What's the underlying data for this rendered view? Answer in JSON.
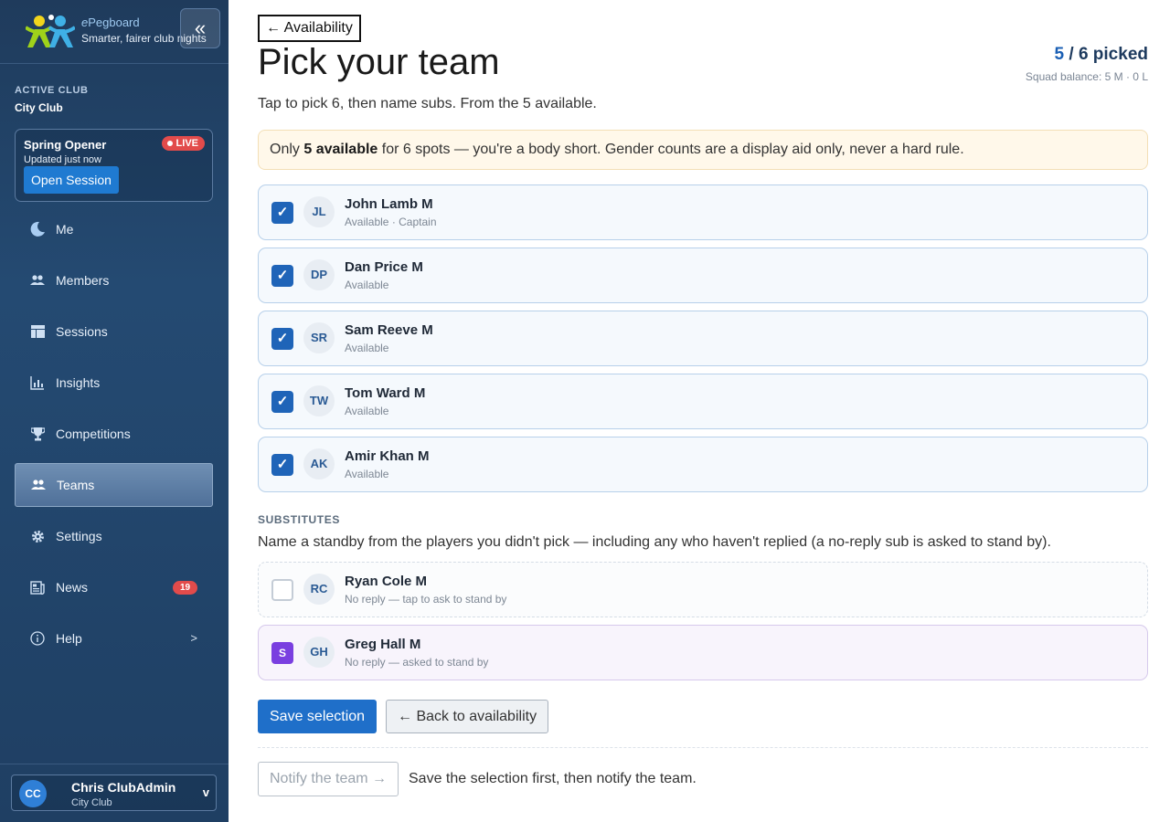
{
  "brand": {
    "name_prefix": "e",
    "name_rest": "Pegboard",
    "tagline": "Smarter, fairer club nights",
    "collapse_label": "«"
  },
  "sidebar": {
    "active_club_label": "ACTIVE CLUB",
    "active_club_name": "City Club",
    "session": {
      "title": "Spring Opener",
      "live_label": "LIVE",
      "updated": "Updated just now",
      "open_button": "Open Session"
    },
    "items": [
      {
        "label": "Me",
        "icon": "moon-icon"
      },
      {
        "label": "Members",
        "icon": "people-icon"
      },
      {
        "label": "Sessions",
        "icon": "layout-icon"
      },
      {
        "label": "Insights",
        "icon": "bar-chart-icon"
      },
      {
        "label": "Competitions",
        "icon": "trophy-icon"
      },
      {
        "label": "Teams",
        "icon": "people-icon",
        "active": true
      },
      {
        "label": "Settings",
        "icon": "gear-icon"
      },
      {
        "label": "News",
        "icon": "news-icon",
        "badge": "19"
      },
      {
        "label": "Help",
        "icon": "info-icon",
        "chevron": ">"
      }
    ],
    "user": {
      "initials": "CC",
      "name": "Chris ClubAdmin",
      "club": "City Club",
      "caret": "v"
    }
  },
  "main": {
    "back_link": "← Availability",
    "title": "Pick your team",
    "picked": {
      "count": "5",
      "separator": "/",
      "total": "6",
      "suffix": "picked"
    },
    "squad_balance": "Squad balance: 5 M · 0 L",
    "subtitle": "Tap to pick 6, then name subs. From the 5 available.",
    "alert": {
      "prefix": "Only",
      "bold": "5 available",
      "rest": "for 6 spots — you're a body short. Gender counts are a display aid only, never a hard rule."
    },
    "players": [
      {
        "initials": "JL",
        "name": "John Lamb M",
        "status": "Available · Captain",
        "check": "✓"
      },
      {
        "initials": "DP",
        "name": "Dan Price M",
        "status": "Available",
        "check": "✓"
      },
      {
        "initials": "SR",
        "name": "Sam Reeve M",
        "status": "Available",
        "check": "✓"
      },
      {
        "initials": "TW",
        "name": "Tom Ward M",
        "status": "Available",
        "check": "✓"
      },
      {
        "initials": "AK",
        "name": "Amir Khan M",
        "status": "Available",
        "check": "✓"
      }
    ],
    "subs_heading": "SUBSTITUTES",
    "subs_desc": "Name a standby from the players you didn't pick — including any who haven't replied (a no-reply sub is asked to stand by).",
    "subs": [
      {
        "initials": "RC",
        "name": "Ryan Cole M",
        "status": "No reply — tap to ask to stand by",
        "check": ""
      },
      {
        "initials": "GH",
        "name": "Greg Hall M",
        "status": "No reply — asked to stand by",
        "check": "S"
      }
    ],
    "save_button": "Save selection",
    "back_button": "← Back to availability",
    "notify_button": "Notify the team →",
    "notify_hint": "Save the selection first, then notify the team."
  },
  "colors": {
    "sidebar_bg": "#244a72",
    "accent": "#1f6fc9",
    "live": "#e24b4b",
    "standby": "#7a3fe0",
    "alert_bg": "#fff8ea"
  }
}
